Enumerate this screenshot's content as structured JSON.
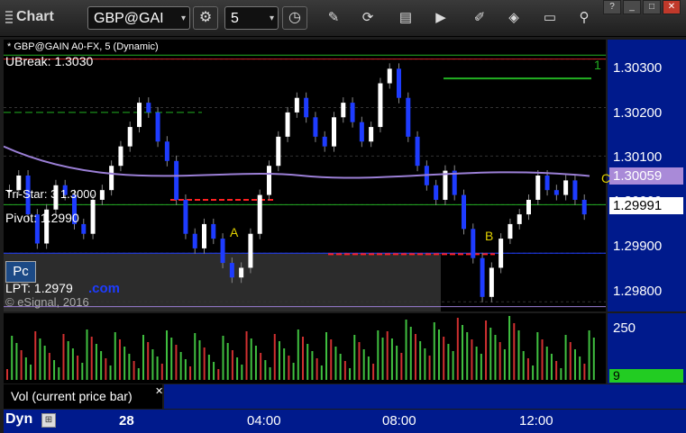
{
  "toolbar": {
    "title": "Chart",
    "symbol": "GBP@GAI",
    "interval": "5",
    "window_buttons": [
      "?",
      "_",
      "□",
      "✕"
    ]
  },
  "chart": {
    "header": "* GBP@GAIN A0-FX, 5 (Dynamic)",
    "ubreak": "UBreak: 1.3030",
    "tri_star": "Tri-Star: 3 1.3000",
    "pivot": "Pivot: 1.2990",
    "pc_label": "Pc",
    "lpt": "LPT: 1.2979",
    "com": ".com",
    "copyright": "© eSignal, 2016",
    "price_ticks": [
      "1.30300",
      "1.30200",
      "1.30100",
      "1.30000",
      "1.29900",
      "1.29800"
    ],
    "ma_value": "1.30059",
    "last_price": "1.29991",
    "c_marker": "C",
    "point_a": "A",
    "point_b": "B",
    "top_count": "1",
    "colors": {
      "up": "#ffffff",
      "down": "#1e3cff",
      "ma": "#9b7fd6",
      "support": "#ff2020",
      "resistance": "#22b022",
      "background": "#000000",
      "axis_bg": "#001a8c",
      "ma_tag": "#a98ad8"
    }
  },
  "volume": {
    "label": "Vol (current price bar)",
    "scale_top": "250",
    "current": "9",
    "current_color": "#22cc22"
  },
  "time_axis": {
    "labels": [
      "28",
      "04:00",
      "08:00",
      "12:00"
    ]
  },
  "footer": {
    "dyn": "Dyn"
  },
  "chart_data": {
    "type": "candlestick",
    "symbol": "GBP@GAIN",
    "interval": "5",
    "y_ticks": [
      1.303,
      1.302,
      1.301,
      1.3,
      1.299,
      1.298
    ],
    "ylim": [
      1.2978,
      1.3034
    ],
    "levels": [
      {
        "name": "UBreak",
        "value": 1.303
      },
      {
        "name": "Tri-Star",
        "value": 1.3
      },
      {
        "name": "Pivot",
        "value": 1.299
      },
      {
        "name": "LPT",
        "value": 1.2979
      }
    ],
    "last_price": 1.29991,
    "ma_value": 1.30059,
    "x_labels": [
      "28",
      "04:00",
      "08:00",
      "12:00"
    ],
    "volume_ylim": [
      0,
      250
    ],
    "volume_current": 9
  }
}
